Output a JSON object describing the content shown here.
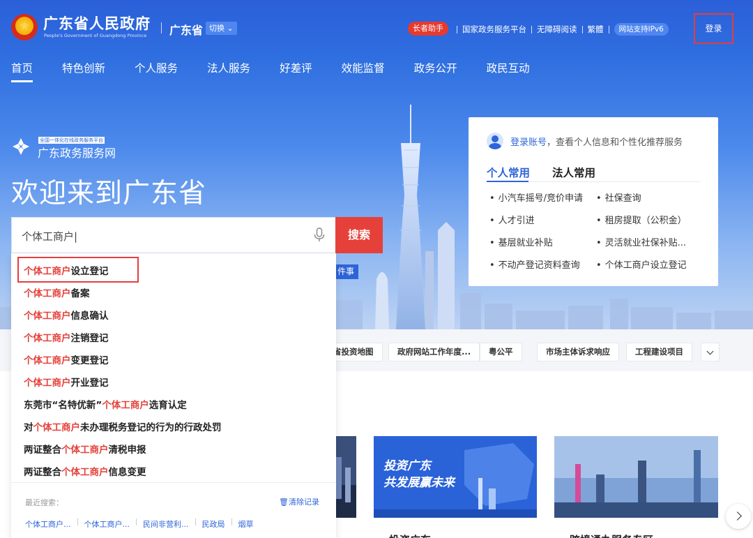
{
  "header": {
    "site_title": "广东省人民政府",
    "site_subtitle": "People's Government of Guangdong Province",
    "region": "广东省",
    "switch_label": "切换",
    "elder_label": "长者助手",
    "links": [
      "国家政务服务平台",
      "无障碍阅读",
      "繁體"
    ],
    "ipv6_label": "网站支持IPv6",
    "login_label": "登录"
  },
  "nav": {
    "items": [
      "首页",
      "特色创新",
      "个人服务",
      "法人服务",
      "好差评",
      "效能监督",
      "政务公开",
      "政民互动"
    ],
    "active_index": 0
  },
  "platform": {
    "tag": "全国一体化在线政务服务平台",
    "name": "广东政务服务网",
    "welcome": "欢迎来到广东省"
  },
  "search": {
    "value": "个体工商户|",
    "button_label": "搜索",
    "peek_label": "件事"
  },
  "suggestions": {
    "items": [
      {
        "pre": "",
        "kw": "个体工商户",
        "post": "设立登记"
      },
      {
        "pre": "",
        "kw": "个体工商户",
        "post": "备案"
      },
      {
        "pre": "",
        "kw": "个体工商户",
        "post": "信息确认"
      },
      {
        "pre": "",
        "kw": "个体工商户",
        "post": "注销登记"
      },
      {
        "pre": "",
        "kw": "个体工商户",
        "post": "变更登记"
      },
      {
        "pre": "",
        "kw": "个体工商户",
        "post": "开业登记"
      },
      {
        "pre": "东莞市“名特优新”",
        "kw": "个体工商户",
        "post": "选育认定"
      },
      {
        "pre": "对",
        "kw": "个体工商户",
        "post": "未办理税务登记的行为的行政处罚"
      },
      {
        "pre": "两证整合",
        "kw": "个体工商户",
        "post": "清税申报"
      },
      {
        "pre": "两证整合",
        "kw": "个体工商户",
        "post": "信息变更"
      }
    ],
    "recent_label": "最近搜索：",
    "clear_label": "清除记录",
    "recent": [
      "个体工商户...",
      "个体工商户...",
      "民间非营利...",
      "民政局",
      "烟草"
    ]
  },
  "panel": {
    "login_link": "登录账号",
    "login_text": "，查看个人信息和个性化推荐服务",
    "tabs": [
      "个人常用",
      "法人常用"
    ],
    "common": [
      "小汽车摇号/竞价申请",
      "社保查询",
      "人才引进",
      "租房提取（公积金）",
      "基层就业补贴",
      "灵活就业社保补贴...",
      "不动产登记资料查询",
      "个体工商户设立登记"
    ]
  },
  "quick_links": [
    "省投资地图",
    "政府网站工作年度...",
    "粤公平",
    "市场主体诉求响应",
    "工程建设项目"
  ],
  "cards": [
    {
      "title": "",
      "banner": ""
    },
    {
      "title": "投资广东",
      "banner": "投资广东",
      "banner2": "共发展赢未来"
    },
    {
      "title": "跨境通办服务专区",
      "banner": ""
    }
  ],
  "colors": {
    "brand_blue": "#2d64d8",
    "accent_red": "#e5413a",
    "highlight_border": "#e53d3d"
  }
}
